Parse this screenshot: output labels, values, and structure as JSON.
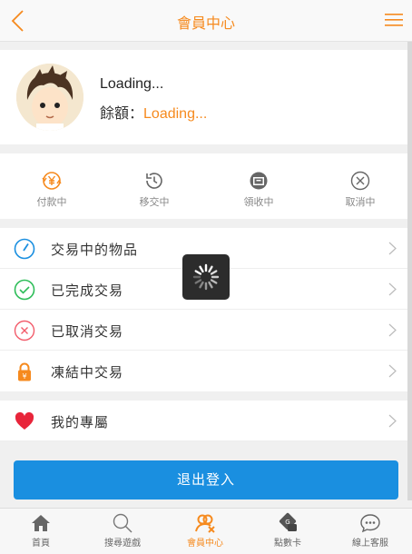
{
  "header": {
    "title": "會員中心"
  },
  "profile": {
    "name": "Loading...",
    "balance_label": "餘額：",
    "balance_value": "Loading..."
  },
  "status": [
    {
      "label": "付款中",
      "icon": "yen-coin-icon"
    },
    {
      "label": "移交中",
      "icon": "history-icon"
    },
    {
      "label": "領收中",
      "icon": "receive-box-icon"
    },
    {
      "label": "取消中",
      "icon": "cancel-circle-icon"
    }
  ],
  "list": [
    {
      "label": "交易中的物品",
      "icon": "gauge-icon"
    },
    {
      "label": "已完成交易",
      "icon": "check-circle-icon"
    },
    {
      "label": "已取消交易",
      "icon": "x-circle-icon"
    },
    {
      "label": "凍結中交易",
      "icon": "lock-icon"
    }
  ],
  "mine": {
    "label": "我的專屬",
    "icon": "heart-icon"
  },
  "logout": {
    "label": "退出登入"
  },
  "tabs": [
    {
      "label": "首頁",
      "icon": "home-icon"
    },
    {
      "label": "搜尋遊戲",
      "icon": "search-icon"
    },
    {
      "label": "會員中心",
      "icon": "member-icon"
    },
    {
      "label": "點數卡",
      "icon": "card-icon"
    },
    {
      "label": "線上客服",
      "icon": "chat-icon"
    }
  ],
  "colors": {
    "accent": "#f68a1e",
    "primary": "#1a8fe0"
  }
}
